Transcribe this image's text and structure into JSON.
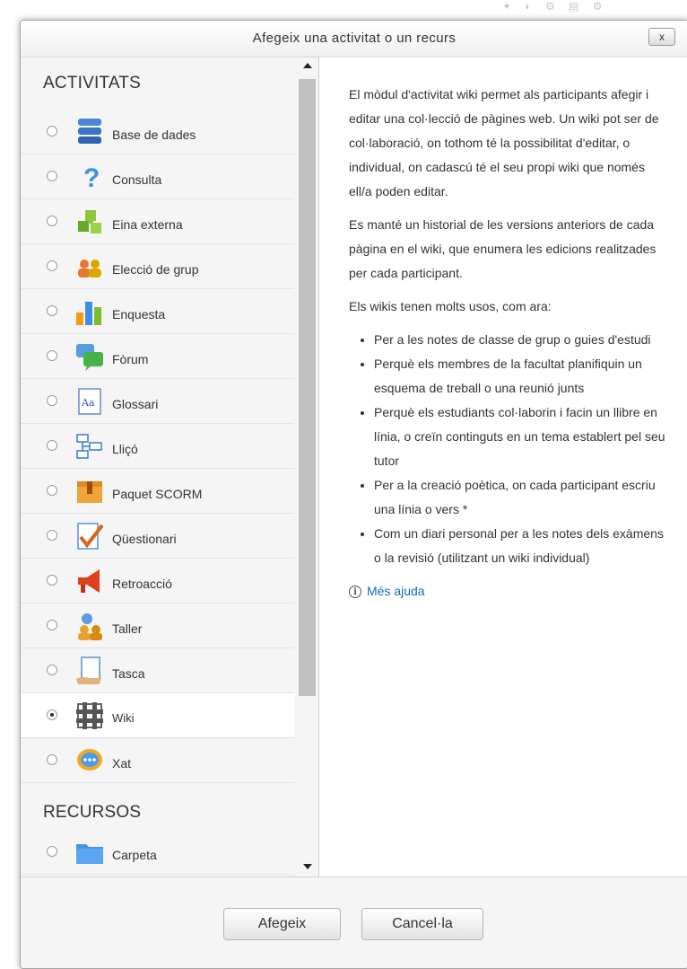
{
  "dialog": {
    "title": "Afegeix una activitat o un recurs",
    "close_label": "x"
  },
  "sections": {
    "activities_heading": "ACTIVITATS",
    "resources_heading": "RECURSOS"
  },
  "activities": [
    {
      "label": "Base de dades",
      "icon": "database-icon",
      "selected": false
    },
    {
      "label": "Consulta",
      "icon": "question-icon",
      "selected": false
    },
    {
      "label": "Eina externa",
      "icon": "puzzle-icon",
      "selected": false
    },
    {
      "label": "Elecció de grup",
      "icon": "group-choice-icon",
      "selected": false
    },
    {
      "label": "Enquesta",
      "icon": "survey-chart-icon",
      "selected": false
    },
    {
      "label": "Fòrum",
      "icon": "forum-icon",
      "selected": false
    },
    {
      "label": "Glossari",
      "icon": "glossary-icon",
      "selected": false
    },
    {
      "label": "Lliçó",
      "icon": "lesson-icon",
      "selected": false
    },
    {
      "label": "Paquet SCORM",
      "icon": "scorm-package-icon",
      "selected": false
    },
    {
      "label": "Qüestionari",
      "icon": "quiz-icon",
      "selected": false
    },
    {
      "label": "Retroacció",
      "icon": "feedback-megaphone-icon",
      "selected": false
    },
    {
      "label": "Taller",
      "icon": "workshop-icon",
      "selected": false
    },
    {
      "label": "Tasca",
      "icon": "assignment-icon",
      "selected": false
    },
    {
      "label": "Wiki",
      "icon": "wiki-icon",
      "selected": true
    },
    {
      "label": "Xat",
      "icon": "chat-icon",
      "selected": false
    }
  ],
  "resources": [
    {
      "label": "Carpeta",
      "icon": "folder-icon",
      "selected": false
    }
  ],
  "help": {
    "p1": "El mòdul d'activitat wiki permet als participants afegir i editar una col·lecció de pàgines web. Un wiki pot ser de col·laboració, on tothom té la possibilitat d'editar, o individual, on cadascú té el seu propi wiki que només ell/a poden editar.",
    "p2": "Es manté un historial de les versions anteriors de cada pàgina en el wiki, que enumera les edicions realitzades per cada participant.",
    "p3": "Els wikis tenen molts usos, com ara:",
    "bullets": [
      "Per a les notes de classe de grup o guies d'estudi",
      "Perquè els membres de la facultat planifiquin un esquema de treball o una reunió junts",
      "Perquè els estudiants col·laborin i facin un llibre en línia, o creïn continguts en un tema establert pel seu tutor",
      "Per a la creació poètica, on cada participant escriu una línia o vers *",
      "Com un diari personal per a les notes dels exàmens o la revisió (utilitzant un wiki individual)"
    ],
    "more_help": "Més ajuda"
  },
  "footer": {
    "add_label": "Afegeix",
    "cancel_label": "Cancel·la"
  },
  "colors": {
    "link": "#0f6cbf",
    "left_pane_bg": "#f5f5f5",
    "selected_row_bg": "#ffffff"
  }
}
